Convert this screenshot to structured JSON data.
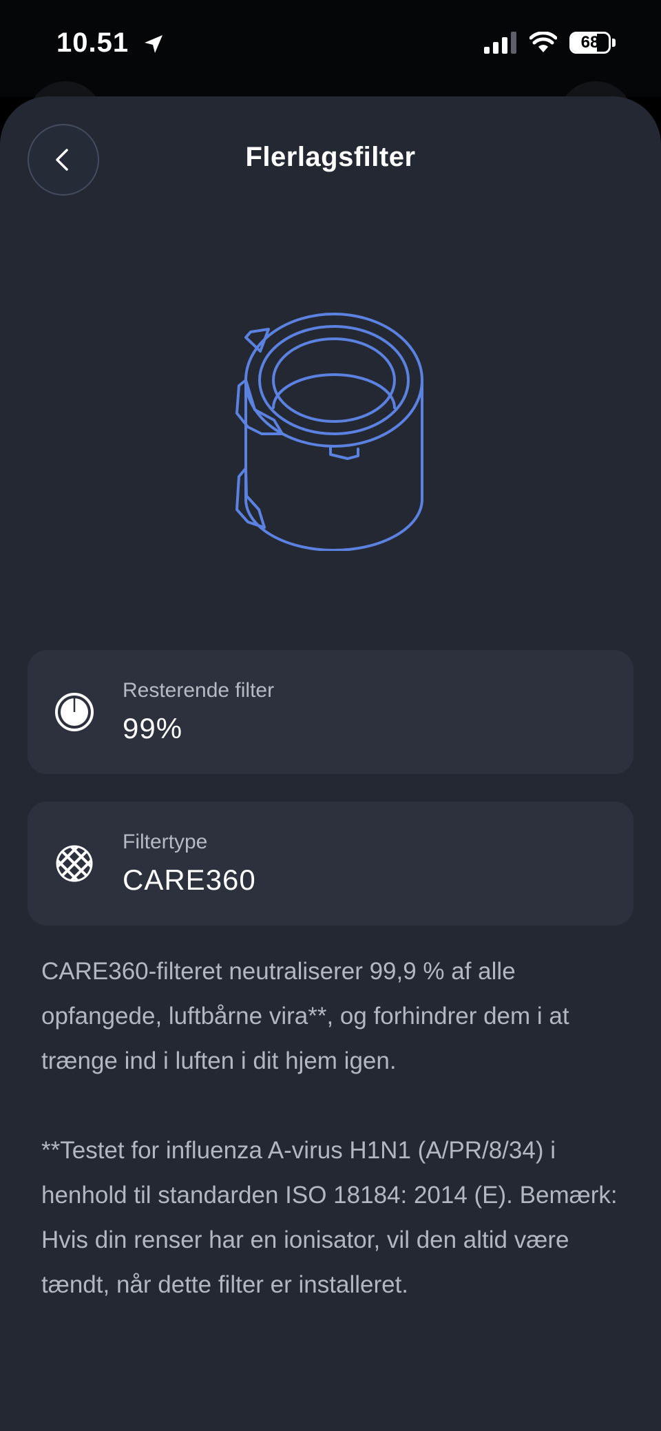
{
  "status_bar": {
    "time": "10.51",
    "battery": "68",
    "battery_level": 0.68
  },
  "header": {
    "title": "Flerlagsfilter"
  },
  "remaining_card": {
    "label": "Resterende filter",
    "value": "99%"
  },
  "type_card": {
    "label": "Filtertype",
    "value": "CARE360"
  },
  "description": {
    "paragraph_1": "CARE360-filteret neutraliserer 99,9 % af alle opfangede, luftbårne vira**, og forhindrer dem i at trænge ind i luften i dit hjem igen.",
    "paragraph_2": "**Testet for influenza A-virus H1N1 (A/PR/8/34) i henhold til standarden ISO 18184: 2014 (E). Bemærk: Hvis din renser har en ionisator, vil den altid være tændt, når dette filter er installeret."
  },
  "colors": {
    "accent": "#5b82e0",
    "sheet_background": "#242832",
    "card_background": "#2d313d"
  },
  "icons": {
    "back": "chevron-left-icon",
    "remaining": "filter-life-icon",
    "type": "mesh-filter-icon",
    "illustration": "filter-cylinder-illustration"
  }
}
